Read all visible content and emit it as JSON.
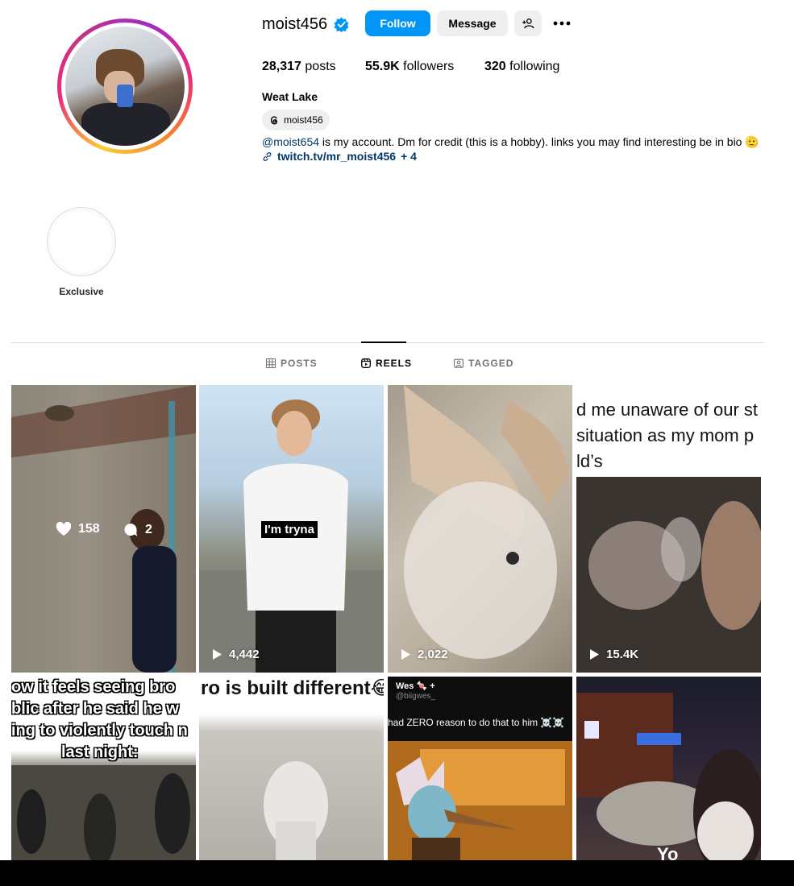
{
  "profile": {
    "username": "moist456",
    "follow_label": "Follow",
    "message_label": "Message",
    "posts_count": "28,317",
    "posts_label": "posts",
    "followers_count": "55.9K",
    "followers_label": "followers",
    "following_count": "320",
    "following_label": "following",
    "full_name": "Weat Lake",
    "threads_handle": "moist456",
    "bio_mention": "@moist654",
    "bio_text": " is my account. Dm for credit (this is a hobby). links you may find interesting be in bio 🫡",
    "link_text": "twitch.tv/mr_moist456",
    "link_more": "+ 4",
    "verified_color": "#0095f6",
    "follow_color": "#0095f6"
  },
  "highlights": [
    {
      "label": "Exclusive"
    }
  ],
  "tabs": [
    {
      "label": "POSTS",
      "active": false,
      "icon": "grid-icon"
    },
    {
      "label": "REELS",
      "active": true,
      "icon": "reels-icon"
    },
    {
      "label": "TAGGED",
      "active": false,
      "icon": "tagged-icon"
    }
  ],
  "reels": [
    {
      "likes": "158",
      "comments": "2"
    },
    {
      "plays": "4,442",
      "caption": "I'm tryna"
    },
    {
      "plays": "2,022"
    },
    {
      "plays": "15.4K",
      "caption_lines": [
        "d me unaware of our st",
        "situation as my mom p",
        "ld’s"
      ]
    },
    {
      "caption_lines": [
        "ow it feels seeing bro",
        "blic after he said he w",
        "ing to violently touch n",
        "last night:"
      ]
    },
    {
      "caption_lines": [
        "ro is built different😂"
      ]
    },
    {
      "header_name": "Wes 🍬 +",
      "header_handle": "@biigwes_",
      "caption_lines": [
        "had ZERO reason to do that to him ☠️☠️"
      ]
    },
    {
      "caption_lines": [
        "Yo"
      ]
    }
  ]
}
